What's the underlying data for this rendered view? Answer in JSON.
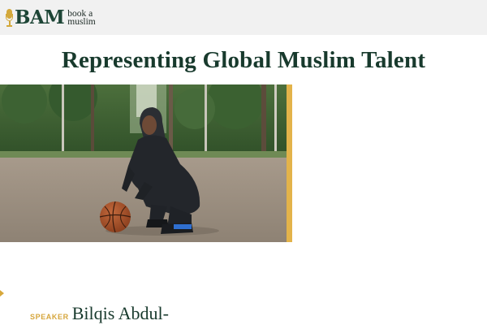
{
  "header": {
    "logo_mark": "BAM",
    "logo_tagline_line1": "book a",
    "logo_tagline_line2": "muslim"
  },
  "main": {
    "title": "Representing Global Muslim Talent",
    "hero_image_alt": "Woman in hijab crouching with a basketball on an outdoor court"
  },
  "speaker": {
    "label": "SPEAKER",
    "name": "Bilqis Abdul-"
  },
  "colors": {
    "header_bg": "#f1f1f1",
    "brand_green": "#1d4536",
    "accent_gold": "#e3b34a"
  }
}
